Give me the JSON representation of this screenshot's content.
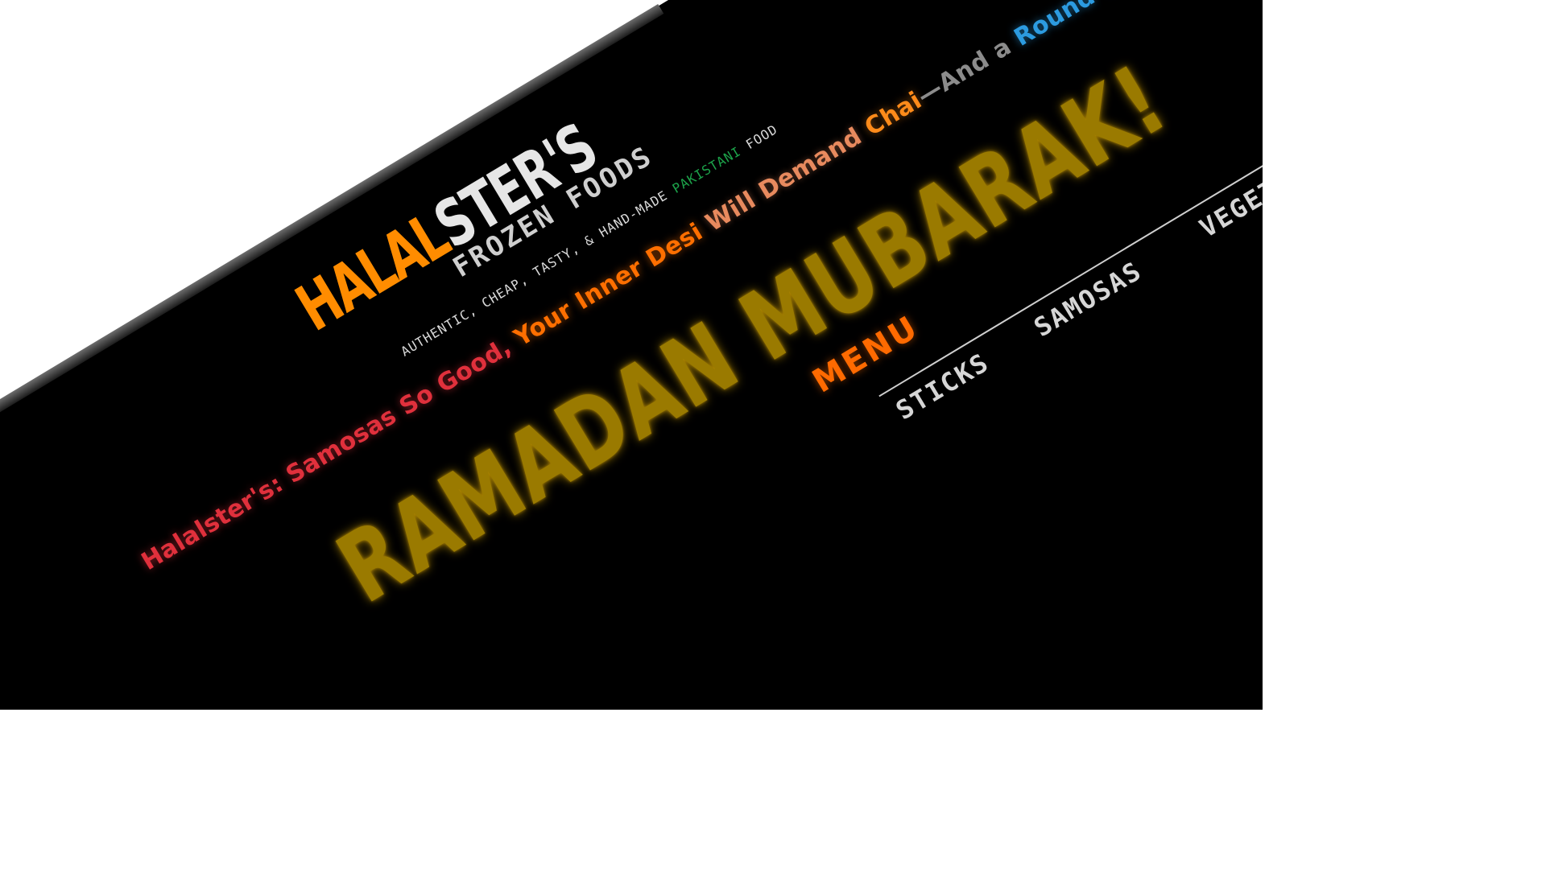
{
  "brand": {
    "halal": "HALAL",
    "ster": "STER'S",
    "frozen": "FROZEN FOODS",
    "tagline_pre": "AUTHENTIC, CHEAP, TASTY, & HAND-MADE ",
    "tagline_highlight": "PAKISTANI",
    "tagline_post": " FOOD"
  },
  "headline": {
    "part1": "Halalster's: Samosas So Good,",
    "part2": " Your Inner Desi",
    "part3": " Will Demand ",
    "part4": "Chai",
    "part5": "—And a ",
    "part6": "Round Two"
  },
  "banner": {
    "text": "RAMADAN MUBARAK!"
  },
  "menu": {
    "title": "MENU",
    "items": [
      "STICKS",
      "SAMOSAS",
      "VEGETABLE"
    ]
  },
  "colors": {
    "brand_orange": "#ff8c00",
    "banner_gold": "#9a7a00",
    "menu_orange": "#ff6a00",
    "accent_blue": "#2c9be0",
    "accent_red": "#e0303c",
    "accent_green": "#1ca34a"
  }
}
